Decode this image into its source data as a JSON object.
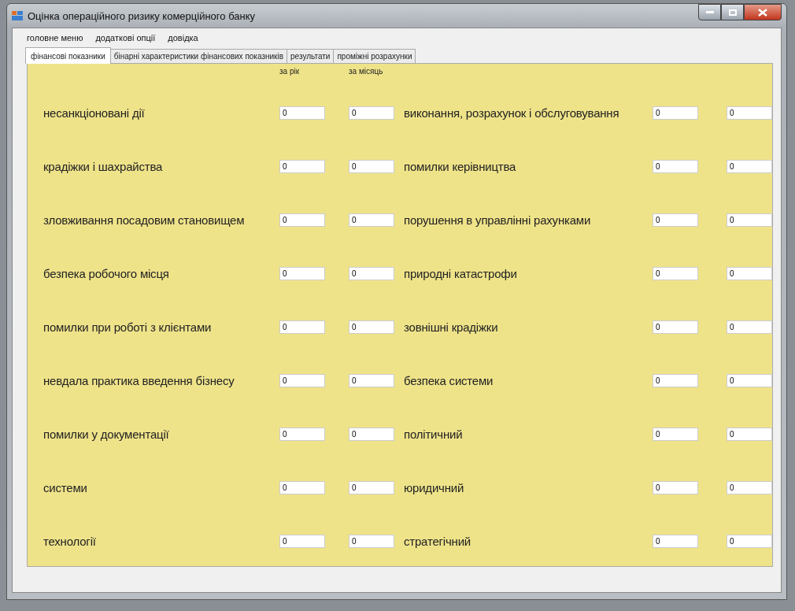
{
  "window": {
    "title": "Оцінка операційного ризику комерційного банку"
  },
  "menu": [
    "головне меню",
    "додаткові опції",
    "довідка"
  ],
  "tabs": [
    {
      "label": "фінансові показники",
      "selected": true
    },
    {
      "label": "бінарні характеристики фінансових показників",
      "selected": false
    },
    {
      "label": "результати",
      "selected": false
    },
    {
      "label": "проміжні розрахунки",
      "selected": false
    }
  ],
  "column_headers": [
    "за рік",
    "за місяць"
  ],
  "left_rows": [
    {
      "label": "несанкціоновані дії",
      "values": [
        "0",
        "0"
      ]
    },
    {
      "label": "крадіжки і шахрайства",
      "values": [
        "0",
        "0"
      ]
    },
    {
      "label": "зловживання посадовим становищем",
      "values": [
        "0",
        "0"
      ]
    },
    {
      "label": "безпека робочого місця",
      "values": [
        "0",
        "0"
      ]
    },
    {
      "label": "помилки при роботі з клієнтами",
      "values": [
        "0",
        "0"
      ]
    },
    {
      "label": "невдала практика введення бізнесу",
      "values": [
        "0",
        "0"
      ]
    },
    {
      "label": "помилки у документації",
      "values": [
        "0",
        "0"
      ]
    },
    {
      "label": "системи",
      "values": [
        "0",
        "0"
      ]
    },
    {
      "label": "технології",
      "values": [
        "0",
        "0"
      ]
    }
  ],
  "right_rows": [
    {
      "label": "виконання, розрахунок і обслуговування",
      "values": [
        "0",
        "0"
      ]
    },
    {
      "label": "помилки керівництва",
      "values": [
        "0",
        "0"
      ]
    },
    {
      "label": "порушення в управлінні рахунками",
      "values": [
        "0",
        "0"
      ]
    },
    {
      "label": "природні катастрофи",
      "values": [
        "0",
        "0"
      ]
    },
    {
      "label": "зовнішні крадіжки",
      "values": [
        "0",
        "0"
      ]
    },
    {
      "label": "безпека системи",
      "values": [
        "0",
        "0"
      ]
    },
    {
      "label": "політичний",
      "values": [
        "0",
        "0"
      ]
    },
    {
      "label": "юридичний",
      "values": [
        "0",
        "0"
      ]
    },
    {
      "label": "стратегічний",
      "values": [
        "0",
        "0"
      ]
    }
  ]
}
